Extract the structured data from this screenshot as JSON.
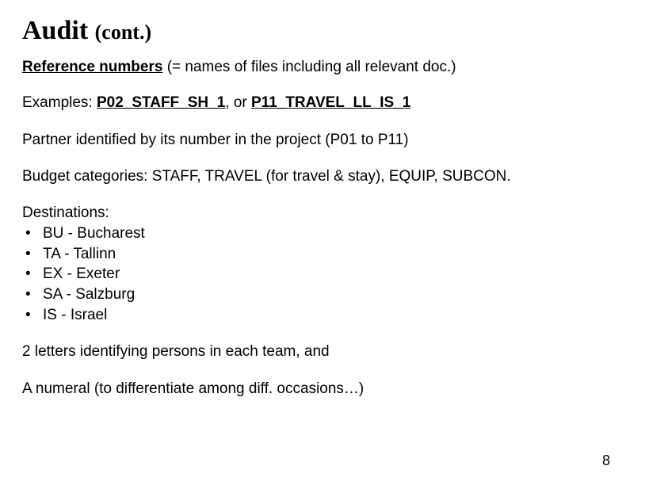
{
  "title_main": "Audit",
  "title_cont": "(cont.)",
  "ref_label": "Reference numbers",
  "ref_paren": "(= names of files including all relevant doc.)",
  "examples_label": "Examples:",
  "example1": "P02_STAFF_SH_1",
  "example_sep": ", or ",
  "example2": "P11_TRAVEL_LL_IS_1",
  "partner_line": "Partner identified by its number in the project (P01 to P11)",
  "budget_line": "Budget categories: STAFF, TRAVEL (for travel & stay), EQUIP, SUBCON.",
  "destinations_label": "Destinations:",
  "destinations": [
    "BU - Bucharest",
    "TA - Tallinn",
    "EX - Exeter",
    "SA - Salzburg",
    "IS - Israel"
  ],
  "letters_line": "2 letters identifying persons in each team, and",
  "numeral_line": "A numeral (to differentiate among diff. occasions…)",
  "page_number": "8"
}
